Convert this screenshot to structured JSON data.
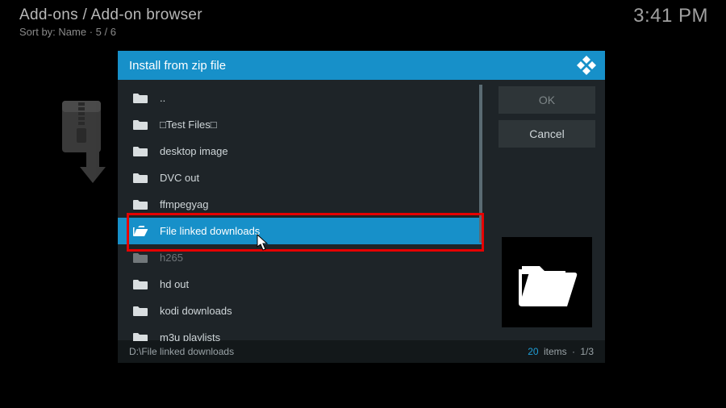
{
  "breadcrumb": "Add-ons / Add-on browser",
  "sort_line": "Sort by: Name  ·  5 / 6",
  "clock": "3:41 PM",
  "dialog": {
    "title": "Install from zip file",
    "ok_label": "OK",
    "cancel_label": "Cancel",
    "path": "D:\\File linked downloads",
    "item_count": "20",
    "items_label": "items",
    "page_indicator": "1/3"
  },
  "files": {
    "items": [
      {
        "label": ".."
      },
      {
        "label": "□Test Files□"
      },
      {
        "label": "desktop image"
      },
      {
        "label": "DVC out"
      },
      {
        "label": "ffmpegyag"
      },
      {
        "label": "File linked downloads",
        "selected": true
      },
      {
        "label": "h265",
        "dim": true
      },
      {
        "label": "hd out"
      },
      {
        "label": "kodi downloads"
      },
      {
        "label": "m3u playlists"
      }
    ]
  }
}
